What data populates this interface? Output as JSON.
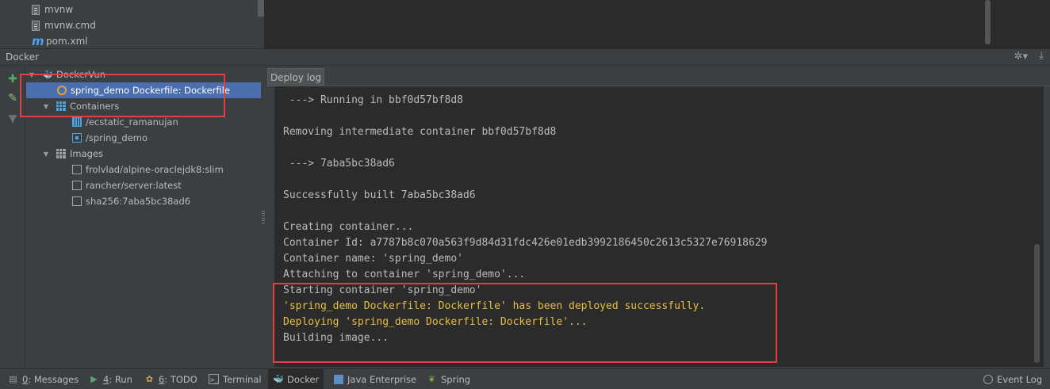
{
  "project_tree": {
    "files": [
      {
        "name": "mvnw",
        "icon": "file-icon"
      },
      {
        "name": "mvnw.cmd",
        "icon": "file-icon"
      },
      {
        "name": "pom.xml",
        "icon": "maven-icon"
      }
    ]
  },
  "tool_window": {
    "title": "Docker",
    "gear_icon": "gear-icon",
    "hide_icon": "hide-icon"
  },
  "tree": {
    "root_label": "DockerVun",
    "deployment_label": "spring_demo Dockerfile: Dockerfile",
    "containers_label": "Containers",
    "containers": [
      "/ecstatic_ramanujan",
      "/spring_demo"
    ],
    "images_label": "Images",
    "images": [
      "frolvlad/alpine-oraclejdk8:slim",
      "rancher/server:latest",
      "sha256:7aba5bc38ad6"
    ]
  },
  "log": {
    "tab_label": "Deploy log",
    "lines": [
      {
        "text": " ---> Running in bbf0d57bf8d8",
        "level": "info"
      },
      {
        "text": "",
        "level": "info"
      },
      {
        "text": "Removing intermediate container bbf0d57bf8d8",
        "level": "info"
      },
      {
        "text": "",
        "level": "info"
      },
      {
        "text": " ---> 7aba5bc38ad6",
        "level": "info"
      },
      {
        "text": "",
        "level": "info"
      },
      {
        "text": "Successfully built 7aba5bc38ad6",
        "level": "info"
      },
      {
        "text": "",
        "level": "info"
      },
      {
        "text": "Creating container...",
        "level": "info"
      },
      {
        "text": "Container Id: a7787b8c070a563f9d84d31fdc426e01edb3992186450c2613c5327e76918629",
        "level": "info"
      },
      {
        "text": "Container name: 'spring_demo'",
        "level": "info"
      },
      {
        "text": "Attaching to container 'spring_demo'...",
        "level": "info"
      },
      {
        "text": "Starting container 'spring_demo'",
        "level": "info"
      },
      {
        "text": "'spring_demo Dockerfile: Dockerfile' has been deployed successfully.",
        "level": "warn"
      },
      {
        "text": "Deploying 'spring_demo Dockerfile: Dockerfile'...",
        "level": "warn"
      },
      {
        "text": "Building image...",
        "level": "info"
      }
    ]
  },
  "status_bar": {
    "messages": {
      "mnemonic": "0",
      "label": ": Messages"
    },
    "run": {
      "mnemonic": "4",
      "label": ": Run"
    },
    "todo": {
      "mnemonic": "6",
      "label": ": TODO"
    },
    "terminal": "Terminal",
    "docker": "Docker",
    "java_enterprise": "Java Enterprise",
    "spring": "Spring",
    "event_log": "Event Log"
  },
  "colors": {
    "selection": "#4b6eaf",
    "highlight_box": "#e04040",
    "warn_text": "#e8bf3f",
    "docker_blue": "#4aa3df"
  }
}
